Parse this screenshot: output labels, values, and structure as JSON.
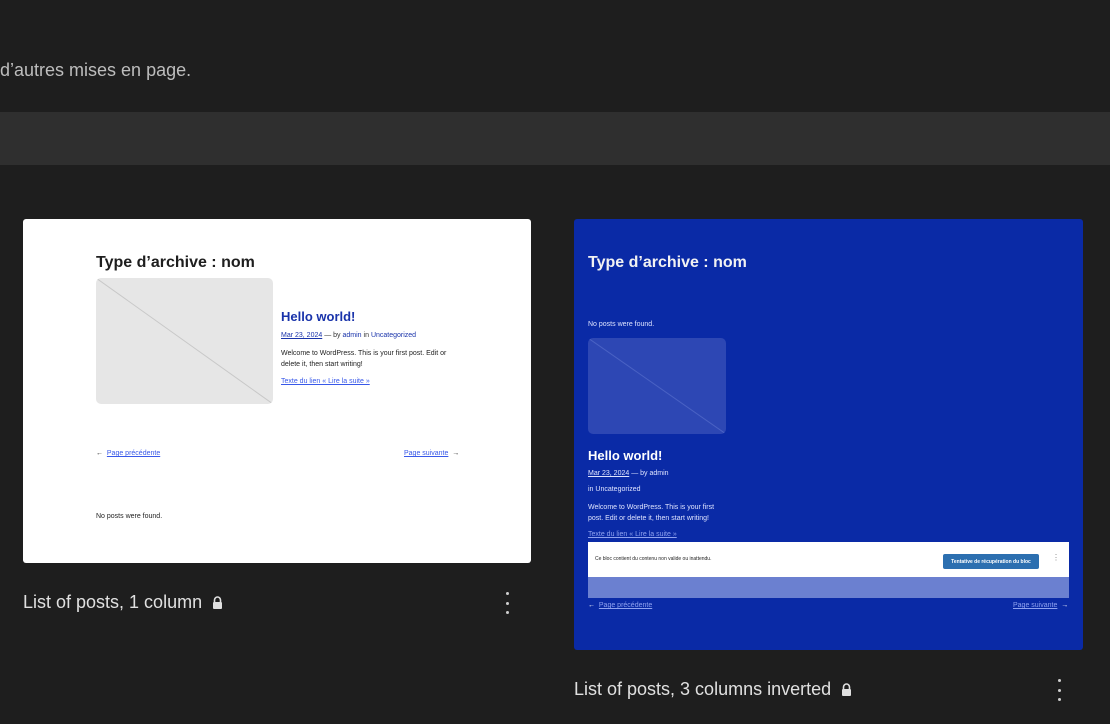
{
  "intro_text": "d’autres mises en page.",
  "patterns": [
    {
      "caption": "List of posts, 1 column",
      "archive_title": "Type d’archive : nom",
      "post_title": "Hello world!",
      "date": "Mar 23, 2024",
      "by_text": "— by",
      "author": "admin",
      "in_text": "in",
      "category": "Uncategorized",
      "excerpt": "Welcome to WordPress. This is your first post. Edit or delete it, then start writing!",
      "read_more": "Texte du lien « Lire la suite »",
      "prev_label": "Page précédente",
      "next_label": "Page suivante",
      "no_posts": "No posts were found.",
      "lock_icon": "lock-icon",
      "more_icon": "more-vertical-icon"
    },
    {
      "caption": "List of posts, 3 columns inverted",
      "archive_title": "Type d’archive : nom",
      "no_posts": "No posts were found.",
      "post_title": "Hello world!",
      "date": "Mar 23, 2024",
      "by_text": "— by admin",
      "category_line": "in Uncategorized",
      "excerpt": "Welcome to WordPress. This is your first post. Edit or delete it, then start writing!",
      "read_more": "Texte du lien « Lire la suite »",
      "warning_text": "Ce bloc contient du contenu non valide ou inattendu.",
      "warning_button": "Tentative de récupération du bloc",
      "warning_more": "⋮",
      "prev_label": "Page précédente",
      "next_label": "Page suivante",
      "lock_icon": "lock-icon",
      "more_icon": "more-vertical-icon"
    }
  ],
  "arrows": {
    "left": "←",
    "right": "→"
  },
  "colors": {
    "background": "#1e1e1e",
    "band": "#2f2f2f",
    "inverted_background": "#0a2aa6",
    "link": "#1933aa",
    "recovery_button": "#2c6fb0"
  }
}
